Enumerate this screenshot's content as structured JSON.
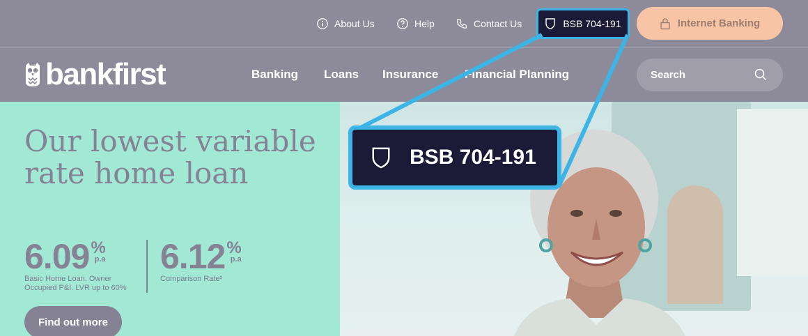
{
  "utility_nav": {
    "about": "About Us",
    "help": "Help",
    "contact": "Contact Us",
    "bsb": "BSB 704-191",
    "internet_banking": "Internet Banking"
  },
  "brand": {
    "name": "bankfirst"
  },
  "main_nav": {
    "items": [
      "Banking",
      "Loans",
      "Insurance",
      "Financial Planning"
    ],
    "search_label": "Search"
  },
  "hero": {
    "title": "Our lowest variable rate home loan",
    "rates": [
      {
        "value": "6.09",
        "unit": "%",
        "period": "p.a",
        "desc": "Basic Home Loan. Owner Occupied P&I. LVR up to 60%"
      },
      {
        "value": "6.12",
        "unit": "%",
        "period": "p.a",
        "desc": "Comparison Rate²"
      }
    ],
    "cta": "Find out more"
  },
  "zoom_callout": {
    "text": "BSB 704-191"
  },
  "colors": {
    "overlay": "#8d8b99",
    "hero_mint": "#a1e8d5",
    "navy": "#1b1a37",
    "highlight_blue": "#3cb4e6",
    "peach": "#f7c4a5"
  }
}
